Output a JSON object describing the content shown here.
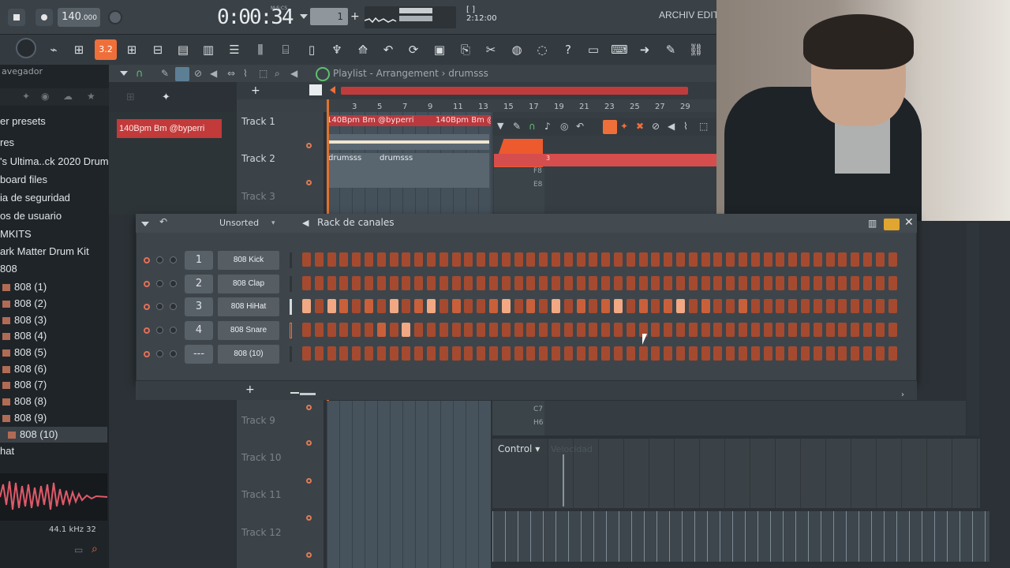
{
  "transport": {
    "tempo": "140",
    "tempo_decimals": ".000",
    "time": "0:00:34",
    "time_unit": "M:S:CS",
    "pattern": "1",
    "position": "2:12:00",
    "hint_prefix": "[ ]",
    "hint_text": "ARCHIV EDITAC"
  },
  "toolbar": {
    "snap_label": "3.2"
  },
  "browser": {
    "header": "avegador",
    "items": [
      {
        "label": "er presets"
      },
      {
        "label": "res"
      },
      {
        "label": "'s Ultima..ck 2020 Drums"
      },
      {
        "label": "board files"
      },
      {
        "label": "ia de seguridad"
      },
      {
        "label": "os de usuario"
      },
      {
        "label": "MKITS"
      },
      {
        "label": "ark Matter Drum Kit"
      },
      {
        "label": "808"
      },
      {
        "label": "808 (1)"
      },
      {
        "label": "808 (2)"
      },
      {
        "label": "808 (3)"
      },
      {
        "label": "808 (4)"
      },
      {
        "label": "808 (5)"
      },
      {
        "label": "808 (6)"
      },
      {
        "label": "808 (7)"
      },
      {
        "label": "808 (8)"
      },
      {
        "label": "808 (9)"
      },
      {
        "label": "808 (10)"
      },
      {
        "label": "hat"
      }
    ],
    "sample_info": "44.1 kHz 32"
  },
  "playlist": {
    "title": "Playlist - Arrangement",
    "pattern_name": "drumsss",
    "ruler": [
      "3",
      "5",
      "7",
      "9",
      "11",
      "13",
      "15",
      "17",
      "19",
      "21",
      "23",
      "25",
      "27",
      "29"
    ],
    "clip_top": "140Bpm Bm @byperri",
    "clip_top2": "140Bpm Bm @byperri",
    "clip_top3": "140Bpm Bm @",
    "gray_clip1": "drumsss",
    "gray_clip2": "drumsss",
    "tracks": [
      {
        "name": "Track 1"
      },
      {
        "name": "Track 2"
      },
      {
        "name": "Track 3"
      },
      {
        "name": "Track 9"
      },
      {
        "name": "Track 10"
      },
      {
        "name": "Track 11"
      },
      {
        "name": "Track 12"
      }
    ]
  },
  "piano": {
    "keys": [
      "F8",
      "E8",
      "C7",
      "H6"
    ],
    "control_label": "Control",
    "velocity_placeholder": "Velocidad",
    "marker": "3"
  },
  "rack": {
    "title": "Rack de canales",
    "filter": "Unsorted",
    "channels": [
      {
        "num": "1",
        "name": "808 Kick",
        "steps": [
          0,
          0,
          0,
          0,
          0,
          0,
          0,
          0,
          0,
          0,
          0,
          0,
          0,
          0,
          0,
          0,
          0,
          0,
          0,
          0,
          0,
          0,
          0,
          0,
          0,
          0,
          0,
          0,
          0,
          0,
          0,
          0,
          0,
          0,
          0,
          0,
          0,
          0,
          0,
          0,
          0,
          0,
          0,
          0,
          0,
          0,
          0,
          0
        ]
      },
      {
        "num": "2",
        "name": "808 Clap",
        "steps": [
          0,
          0,
          0,
          0,
          0,
          0,
          0,
          0,
          0,
          0,
          0,
          0,
          0,
          0,
          0,
          0,
          0,
          0,
          0,
          0,
          0,
          0,
          0,
          0,
          0,
          0,
          0,
          0,
          0,
          0,
          0,
          0,
          0,
          0,
          0,
          0,
          0,
          0,
          0,
          0,
          0,
          0,
          0,
          0,
          0,
          0,
          0,
          0
        ]
      },
      {
        "num": "3",
        "name": "808 HiHat",
        "steps": [
          2,
          0,
          2,
          1,
          0,
          1,
          0,
          2,
          0,
          1,
          2,
          0,
          1,
          0,
          0,
          1,
          2,
          0,
          1,
          0,
          2,
          0,
          1,
          0,
          1,
          2,
          0,
          1,
          0,
          1,
          2,
          0,
          1,
          0,
          0,
          1,
          0,
          0,
          0,
          0,
          0,
          0,
          0,
          0,
          0,
          0,
          0,
          0
        ]
      },
      {
        "num": "4",
        "name": "808 Snare",
        "steps": [
          0,
          0,
          0,
          0,
          0,
          0,
          1,
          0,
          2,
          0,
          0,
          0,
          0,
          0,
          0,
          0,
          0,
          0,
          0,
          0,
          0,
          0,
          0,
          0,
          0,
          0,
          0,
          0,
          0,
          0,
          0,
          0,
          0,
          0,
          0,
          0,
          0,
          0,
          0,
          0,
          0,
          0,
          0,
          0,
          0,
          0,
          0,
          0
        ]
      },
      {
        "num": "---",
        "name": "808 (10)",
        "steps": [
          0,
          0,
          0,
          0,
          0,
          0,
          0,
          0,
          0,
          0,
          0,
          0,
          0,
          0,
          0,
          0,
          0,
          0,
          0,
          0,
          0,
          0,
          0,
          0,
          0,
          0,
          0,
          0,
          0,
          0,
          0,
          0,
          0,
          0,
          0,
          0,
          0,
          0,
          0,
          0,
          0,
          0,
          0,
          0,
          0,
          0,
          0,
          0
        ]
      }
    ]
  },
  "colors": {
    "accent": "#ef6f3a",
    "clip_red": "#c23a3a",
    "step_off": "#a64a2f",
    "step_mid": "#c9603a",
    "step_on": "#f2a882"
  }
}
